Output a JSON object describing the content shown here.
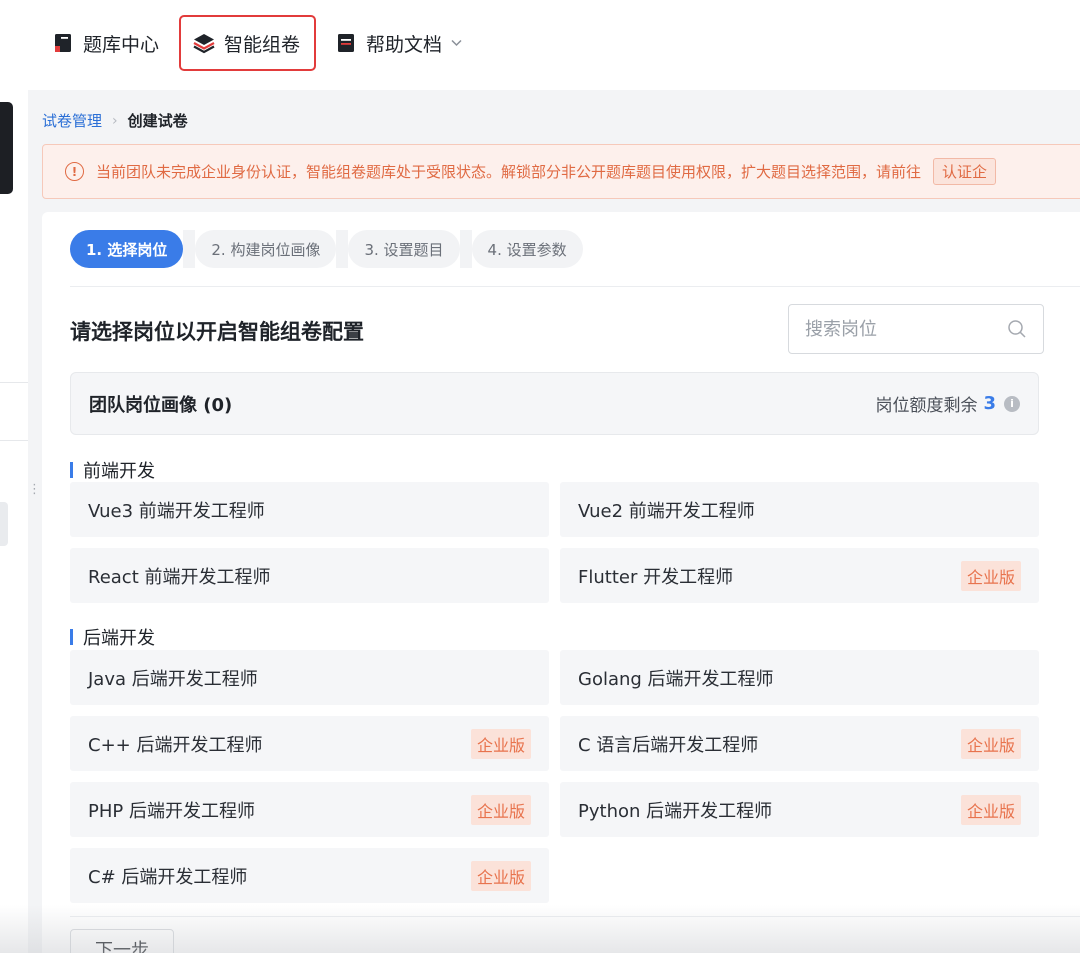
{
  "topnav": {
    "items": [
      {
        "label": "题库中心",
        "icon": "book-icon"
      },
      {
        "label": "智能组卷",
        "icon": "layers-icon",
        "active": true
      },
      {
        "label": "帮助文档",
        "icon": "document-icon",
        "has_dropdown": true
      }
    ]
  },
  "breadcrumb": {
    "parent": "试卷管理",
    "current": "创建试卷"
  },
  "alert": {
    "text": "当前团队未完成企业身份认证，智能组卷题库处于受限状态。解锁部分非公开题库题目使用权限，扩大题目选择范围，请前往",
    "action": "认证企"
  },
  "steps": [
    {
      "label": "1. 选择岗位",
      "active": true
    },
    {
      "label": "2. 构建岗位画像"
    },
    {
      "label": "3. 设置题目"
    },
    {
      "label": "4. 设置参数"
    }
  ],
  "main": {
    "title": "请选择岗位以开启智能组卷配置",
    "search_placeholder": "搜索岗位"
  },
  "team": {
    "title": "团队岗位画像 (0)",
    "quota_label": "岗位额度剩余",
    "quota_value": "3"
  },
  "badge_label": "企业版",
  "groups": [
    {
      "title": "前端开发",
      "positions": [
        {
          "name": "Vue3 前端开发工程师",
          "enterprise": false
        },
        {
          "name": "Vue2 前端开发工程师",
          "enterprise": false
        },
        {
          "name": "React 前端开发工程师",
          "enterprise": false
        },
        {
          "name": "Flutter 开发工程师",
          "enterprise": true
        }
      ]
    },
    {
      "title": "后端开发",
      "positions": [
        {
          "name": "Java 后端开发工程师",
          "enterprise": false
        },
        {
          "name": "Golang 后端开发工程师",
          "enterprise": false
        },
        {
          "name": "C++ 后端开发工程师",
          "enterprise": true
        },
        {
          "name": "C 语言后端开发工程师",
          "enterprise": true
        },
        {
          "name": "PHP 后端开发工程师",
          "enterprise": true
        },
        {
          "name": "Python 后端开发工程师",
          "enterprise": true
        },
        {
          "name": "C# 后端开发工程师",
          "enterprise": true
        }
      ]
    }
  ],
  "footer": {
    "next_label": "下一步"
  },
  "colors": {
    "primary": "#3a7ce8",
    "alert": "#e06a43",
    "highlight_border": "#e23b3b",
    "badge": "#e8734d"
  }
}
